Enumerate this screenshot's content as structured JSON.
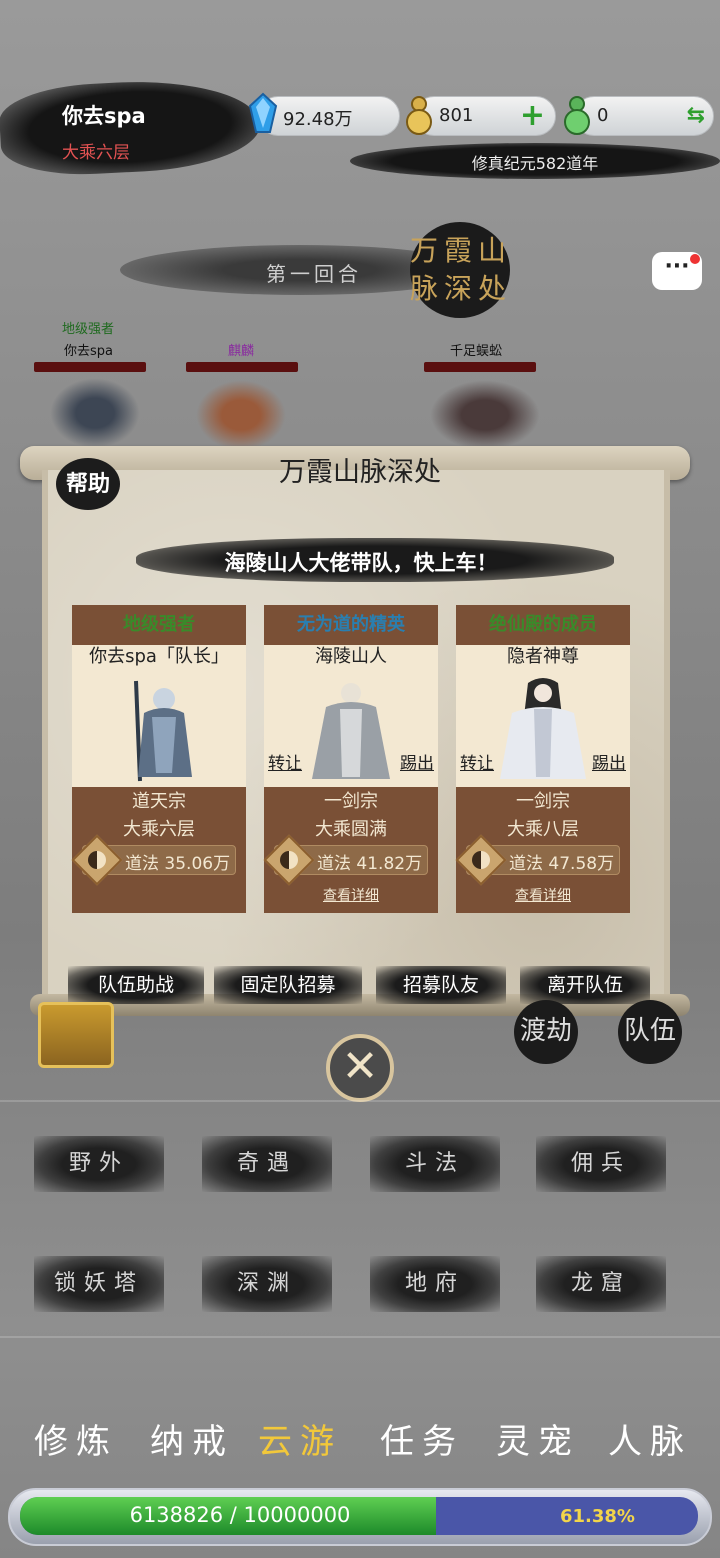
{
  "player": {
    "name": "你去spa",
    "realm": "大乘六层"
  },
  "resources": [
    {
      "icon": "blue-crystal-icon",
      "value": "92.48万"
    },
    {
      "icon": "gold-gourd-icon",
      "value": "801",
      "action": "+"
    },
    {
      "icon": "jade-gourd-icon",
      "value": "0",
      "action": "⇆"
    }
  ],
  "era": "修真纪元582道年",
  "battle": {
    "round": "第一回合",
    "location": "万霞山脉深处",
    "units": [
      {
        "title": "地级强者",
        "name": "你去spa"
      },
      {
        "title": "",
        "name": "麒麟"
      },
      {
        "title": "",
        "name": "千足蜈蚣"
      }
    ]
  },
  "panel": {
    "title": "万霞山脉深处",
    "help": "帮助",
    "slogan": "海陵山人大佬带队，快上车！",
    "members": [
      {
        "tag": "地级强者",
        "tag_color": "#3a8a2a",
        "name": "你去spa「队长」",
        "sect": "道天宗",
        "realm": "大乘六层",
        "dao": "道法 35.06万",
        "detail": ""
      },
      {
        "tag": "无为道的精英",
        "tag_color": "#2a7fb0",
        "name": "海陵山人",
        "sect": "一剑宗",
        "realm": "大乘圆满",
        "dao": "道法 41.82万",
        "detail": "查看详细",
        "transfer": "转让",
        "kick": "踢出"
      },
      {
        "tag": "绝仙殿的成员",
        "tag_color": "#3a8a2a",
        "name": "隐者神尊",
        "sect": "一剑宗",
        "realm": "大乘八层",
        "dao": "道法 47.58万",
        "detail": "查看详细",
        "transfer": "转让",
        "kick": "踢出"
      }
    ],
    "actions": [
      "队伍助战",
      "固定队招募",
      "招募队友",
      "离开队伍"
    ]
  },
  "side_buttons": {
    "tribulation": "渡劫",
    "team": "队伍"
  },
  "areas": [
    "野外",
    "奇遇",
    "斗法",
    "佣兵",
    "锁妖塔",
    "深渊",
    "地府",
    "龙窟"
  ],
  "nav": [
    {
      "label": "修炼"
    },
    {
      "label": "纳戒"
    },
    {
      "label": "云游",
      "active": true
    },
    {
      "label": "任务"
    },
    {
      "label": "灵宠"
    },
    {
      "label": "人脉"
    }
  ],
  "exp": {
    "text": "6138826 / 10000000",
    "percent_label": "61.38%",
    "fraction": 0.6139
  }
}
